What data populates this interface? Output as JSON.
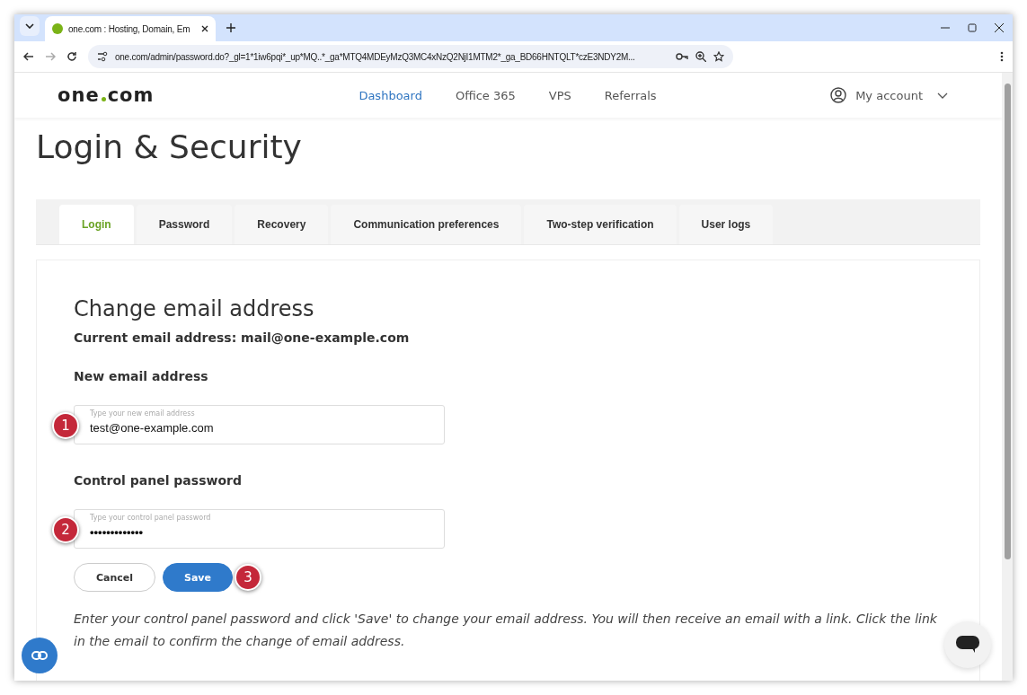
{
  "browser": {
    "tab_title": "one.com : Hosting, Domain, Em",
    "url": "one.com/admin/password.do?_gl=1*1iw6pqi*_up*MQ..*_ga*MTQ4MDEyMzQ3MC4xNzQ2NjI1MTM2*_ga_BD66HNTQLT*czE3NDY2M..."
  },
  "site": {
    "logo_left": "one",
    "logo_right": "com",
    "nav": [
      {
        "label": "Dashboard",
        "selected": true
      },
      {
        "label": "Office 365",
        "selected": false
      },
      {
        "label": "VPS",
        "selected": false
      },
      {
        "label": "Referrals",
        "selected": false
      }
    ],
    "account": "My account"
  },
  "page_title": "Login & Security",
  "tabs": [
    {
      "label": "Login",
      "selected": true
    },
    {
      "label": "Password",
      "selected": false
    },
    {
      "label": "Recovery",
      "selected": false
    },
    {
      "label": "Communication preferences",
      "selected": false
    },
    {
      "label": "Two-step verification",
      "selected": false
    },
    {
      "label": "User logs",
      "selected": false
    }
  ],
  "form": {
    "heading": "Change email address",
    "current": "Current email address: mail@one-example.com",
    "fields": [
      {
        "label": "New email address",
        "placeholder": "Type your new email address",
        "value": "test@one-example.com",
        "kind": "text",
        "marker": "1"
      },
      {
        "label": "Control panel password",
        "placeholder": "Type your control panel password",
        "value": "•••••••••••••",
        "kind": "password",
        "marker": "2"
      }
    ],
    "cancel": "Cancel",
    "save": "Save",
    "save_marker": "3",
    "note": "Enter your control panel password and click 'Save' to change your email address. You will then receive an email with a link. Click the link in the email to confirm the change of email address."
  }
}
